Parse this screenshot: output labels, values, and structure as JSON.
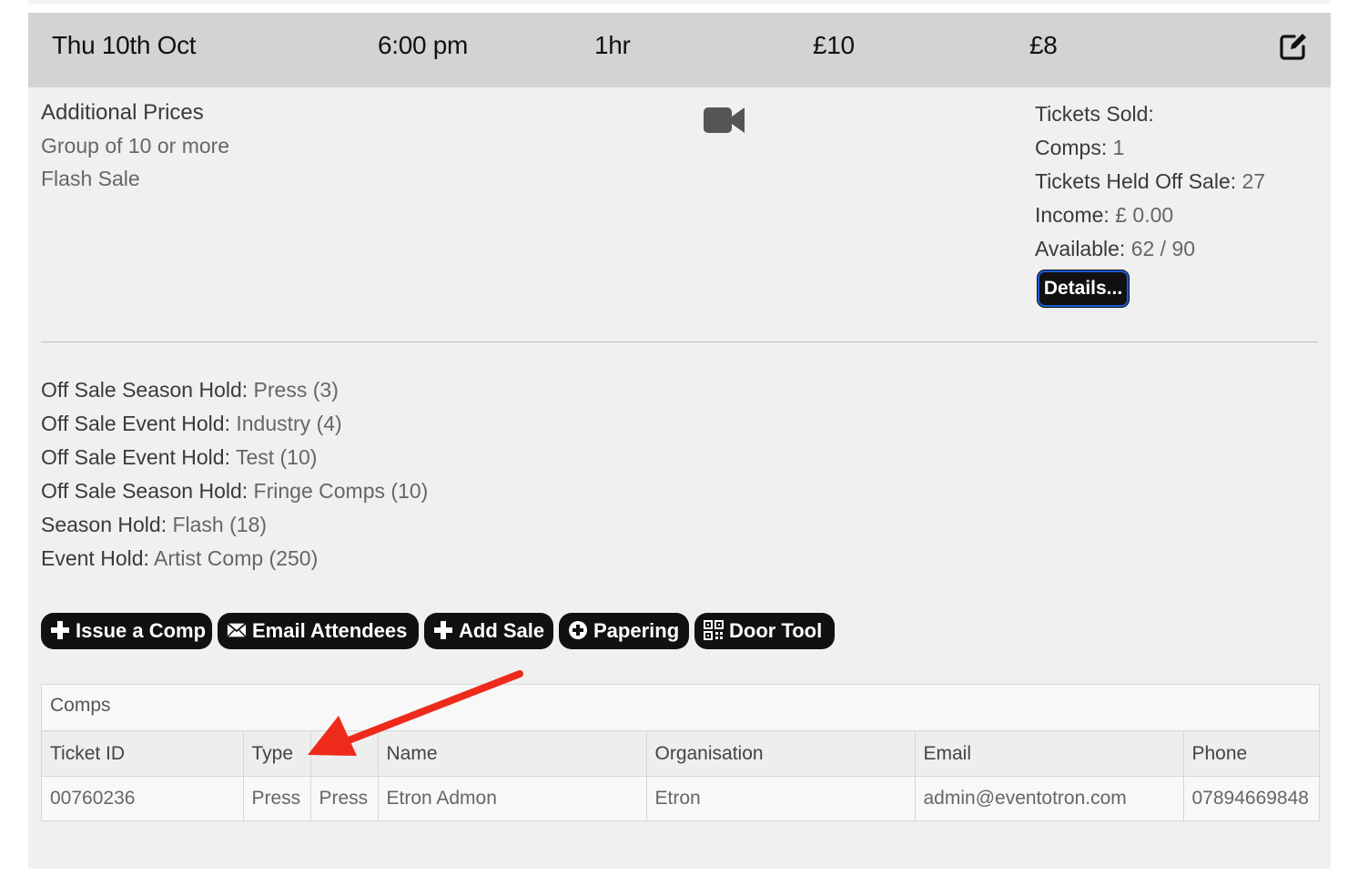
{
  "header": {
    "date": "Thu 10th Oct",
    "time": "6:00 pm",
    "duration": "1hr",
    "price_full": "£10",
    "price_concession": "£8",
    "edit_icon": "edit-icon"
  },
  "additional_prices": {
    "title": "Additional Prices",
    "items": [
      "Group of 10 or more",
      "Flash Sale"
    ]
  },
  "media_icon": "video-camera-icon",
  "stats": {
    "rows": [
      {
        "label": "Tickets Sold:",
        "value": ""
      },
      {
        "label": "Comps:",
        "value": " 1"
      },
      {
        "label": "Tickets Held Off Sale:",
        "value": " 27"
      },
      {
        "label": "Income:",
        "value": " £ 0.00"
      },
      {
        "label": "Available:",
        "value": " 62 / 90"
      }
    ],
    "details_button": "Details..."
  },
  "holds": [
    {
      "label": "Off Sale Season Hold:",
      "value": " Press (3)"
    },
    {
      "label": "Off Sale Event Hold:",
      "value": " Industry (4)"
    },
    {
      "label": "Off Sale Event Hold:",
      "value": " Test (10)"
    },
    {
      "label": "Off Sale Season Hold:",
      "value": " Fringe Comps (10)"
    },
    {
      "label": "Season Hold:",
      "value": " Flash (18)"
    },
    {
      "label": "Event Hold:",
      "value": " Artist Comp (250)"
    }
  ],
  "actions": [
    {
      "label": "Issue a Comp",
      "icon": "plus-icon"
    },
    {
      "label": "Email Attendees",
      "icon": "envelope-icon"
    },
    {
      "label": "Add Sale",
      "icon": "plus-icon"
    },
    {
      "label": "Papering",
      "icon": "plus-circle-icon"
    },
    {
      "label": "Door Tool",
      "icon": "qr-code-icon"
    }
  ],
  "comps": {
    "title": "Comps",
    "columns": [
      "Ticket ID",
      "Type",
      "",
      "Name",
      "Organisation",
      "Email",
      "Phone"
    ],
    "rows": [
      [
        "00760236",
        "Press",
        "Press",
        "Etron Admon",
        "Etron",
        "admin@eventotron.com",
        "07894669848"
      ]
    ]
  },
  "annotation": {
    "color": "#ee2a1b"
  }
}
